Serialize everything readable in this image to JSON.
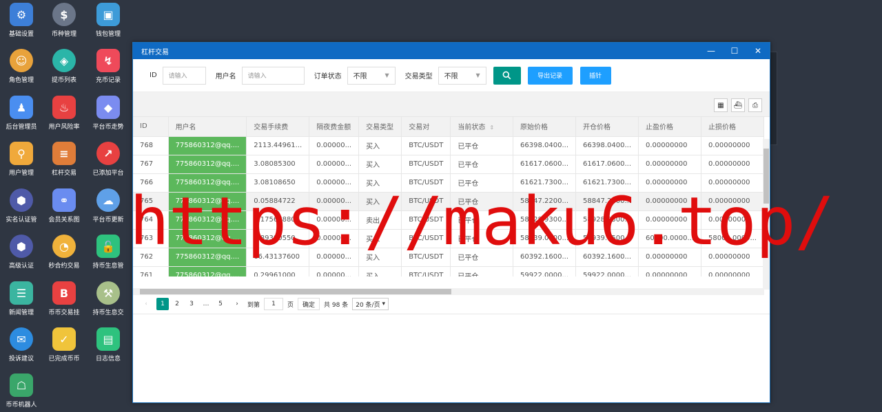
{
  "desktop": {
    "icons": [
      {
        "label": "基础设置",
        "icon": "gear-icon",
        "color": "#3d7fd8"
      },
      {
        "label": "币种管理",
        "icon": "dollar-icon",
        "color": "#6b7689"
      },
      {
        "label": "钱包管理",
        "icon": "wallet-icon",
        "color": "#3d9bd8"
      },
      {
        "label": "角色管理",
        "icon": "role-icon",
        "color": "#e8a23b"
      },
      {
        "label": "提币列表",
        "icon": "withdraw-icon",
        "color": "#2bb5a8"
      },
      {
        "label": "充币记录",
        "icon": "chart-down-icon",
        "color": "#ef4a5a"
      },
      {
        "label": "后台管理员",
        "icon": "admin-icon",
        "color": "#4a8ef0"
      },
      {
        "label": "用户风险率",
        "icon": "alarm-icon",
        "color": "#e84141"
      },
      {
        "label": "平台币走势",
        "icon": "layers-icon",
        "color": "#7b8cf0"
      },
      {
        "label": "用户管理",
        "icon": "user-search-icon",
        "color": "#f0a93b"
      },
      {
        "label": "杠杆交易",
        "icon": "stack-icon",
        "color": "#e07d39"
      },
      {
        "label": "已添加平台",
        "icon": "trend-icon",
        "color": "#e84141"
      },
      {
        "label": "实名认证管",
        "icon": "id-verify-icon",
        "color": "#4f5aa8"
      },
      {
        "label": "会员关系图",
        "icon": "network-icon",
        "color": "#6a8cf0"
      },
      {
        "label": "平台币更新",
        "icon": "cloud-refresh-icon",
        "color": "#5fa0e8"
      },
      {
        "label": "高级认证",
        "icon": "advanced-verify-icon",
        "color": "#4f5aa8"
      },
      {
        "label": "秒合约交易",
        "icon": "timer-icon",
        "color": "#f0b23b"
      },
      {
        "label": "持币生息管",
        "icon": "lock-icon",
        "color": "#2ec27e"
      },
      {
        "label": "新闻管理",
        "icon": "news-icon",
        "color": "#3bb5a0"
      },
      {
        "label": "币币交易挂",
        "icon": "bitcoin-icon",
        "color": "#e84141"
      },
      {
        "label": "持币生息交",
        "icon": "hammer-icon",
        "color": "#a8c08a"
      },
      {
        "label": "投诉建议",
        "icon": "mail-icon",
        "color": "#2d8ce0"
      },
      {
        "label": "已完成币币",
        "icon": "check-box-icon",
        "color": "#f0c43b"
      },
      {
        "label": "日志信息",
        "icon": "log-icon",
        "color": "#2ec27e"
      },
      {
        "label": "币币机器人",
        "icon": "robot-icon",
        "color": "#3aa66a"
      }
    ]
  },
  "window": {
    "title": "杠杆交易",
    "minimize": "—",
    "maximize": "☐",
    "close": "✕"
  },
  "filters": {
    "id_label": "ID",
    "id_placeholder": "请输入",
    "user_label": "用户名",
    "user_placeholder": "请输入",
    "order_status_label": "订单状态",
    "order_status_value": "不限",
    "trade_type_label": "交易类型",
    "trade_type_value": "不限",
    "search_icon": "search-icon",
    "export_label": "导出记录",
    "stats_label": "插针"
  },
  "table": {
    "columns": [
      "ID",
      "用户名",
      "交易手续费",
      "隔夜费金额",
      "交易类型",
      "交易对",
      "当前状态",
      "原始价格",
      "开仓价格",
      "止盈价格",
      "止损价格"
    ],
    "rows": [
      [
        "768",
        "775860312@qq....",
        "2113.44961...",
        "0.00000...",
        "买入",
        "BTC/USDT",
        "已平仓",
        "66398.0400...",
        "66398.0400...",
        "0.00000000",
        "0.00000000"
      ],
      [
        "767",
        "775860312@qq....",
        "3.08085300",
        "0.00000...",
        "买入",
        "BTC/USDT",
        "已平仓",
        "61617.0600...",
        "61617.0600...",
        "0.00000000",
        "0.00000000"
      ],
      [
        "766",
        "775860312@qq....",
        "3.08108650",
        "0.00000...",
        "买入",
        "BTC/USDT",
        "已平仓",
        "61621.7300...",
        "61621.7300...",
        "0.00000000",
        "0.00000000"
      ],
      [
        "765",
        "775860312@qq....",
        "0.05884722",
        "0.00000...",
        "买入",
        "BTC/USDT",
        "已平仓",
        "58847.2200...",
        "58847.2200...",
        "0.00000000",
        "0.00000000"
      ],
      [
        "764",
        "775860312@qq....",
        "1.17567880",
        "0.00000...",
        "卖出",
        "BTC/USDT",
        "已平仓",
        "58928.9300...",
        "58928.9300...",
        "0.00000000",
        "0.00000000"
      ],
      [
        "763",
        "775860312@qq....",
        "5.89390550",
        "0.00000...",
        "买入",
        "BTC/USDT",
        "已平仓",
        "58939.0500...",
        "58939.0500...",
        "60000.0000...",
        "58000.0000..."
      ],
      [
        "762",
        "775860312@qq....",
        "66.43137600",
        "0.00000...",
        "买入",
        "BTC/USDT",
        "已平仓",
        "60392.1600...",
        "60392.1600...",
        "0.00000000",
        "0.00000000"
      ],
      [
        "761",
        "775860312@qq....",
        "0.29961000",
        "0.00000...",
        "买入",
        "BTC/USDT",
        "已平仓",
        "59922.0000...",
        "59922.0000...",
        "0.00000000",
        "0.00000000"
      ]
    ]
  },
  "pager": {
    "prev": "‹",
    "pages": [
      "1",
      "2",
      "3",
      "…",
      "5"
    ],
    "current": "1",
    "next": "›",
    "goto_label": "到第",
    "goto_value": "1",
    "page_unit": "页",
    "confirm": "确定",
    "total": "共 98 条",
    "page_size": "20 条/页"
  },
  "watermark": "https://maku6.top/"
}
